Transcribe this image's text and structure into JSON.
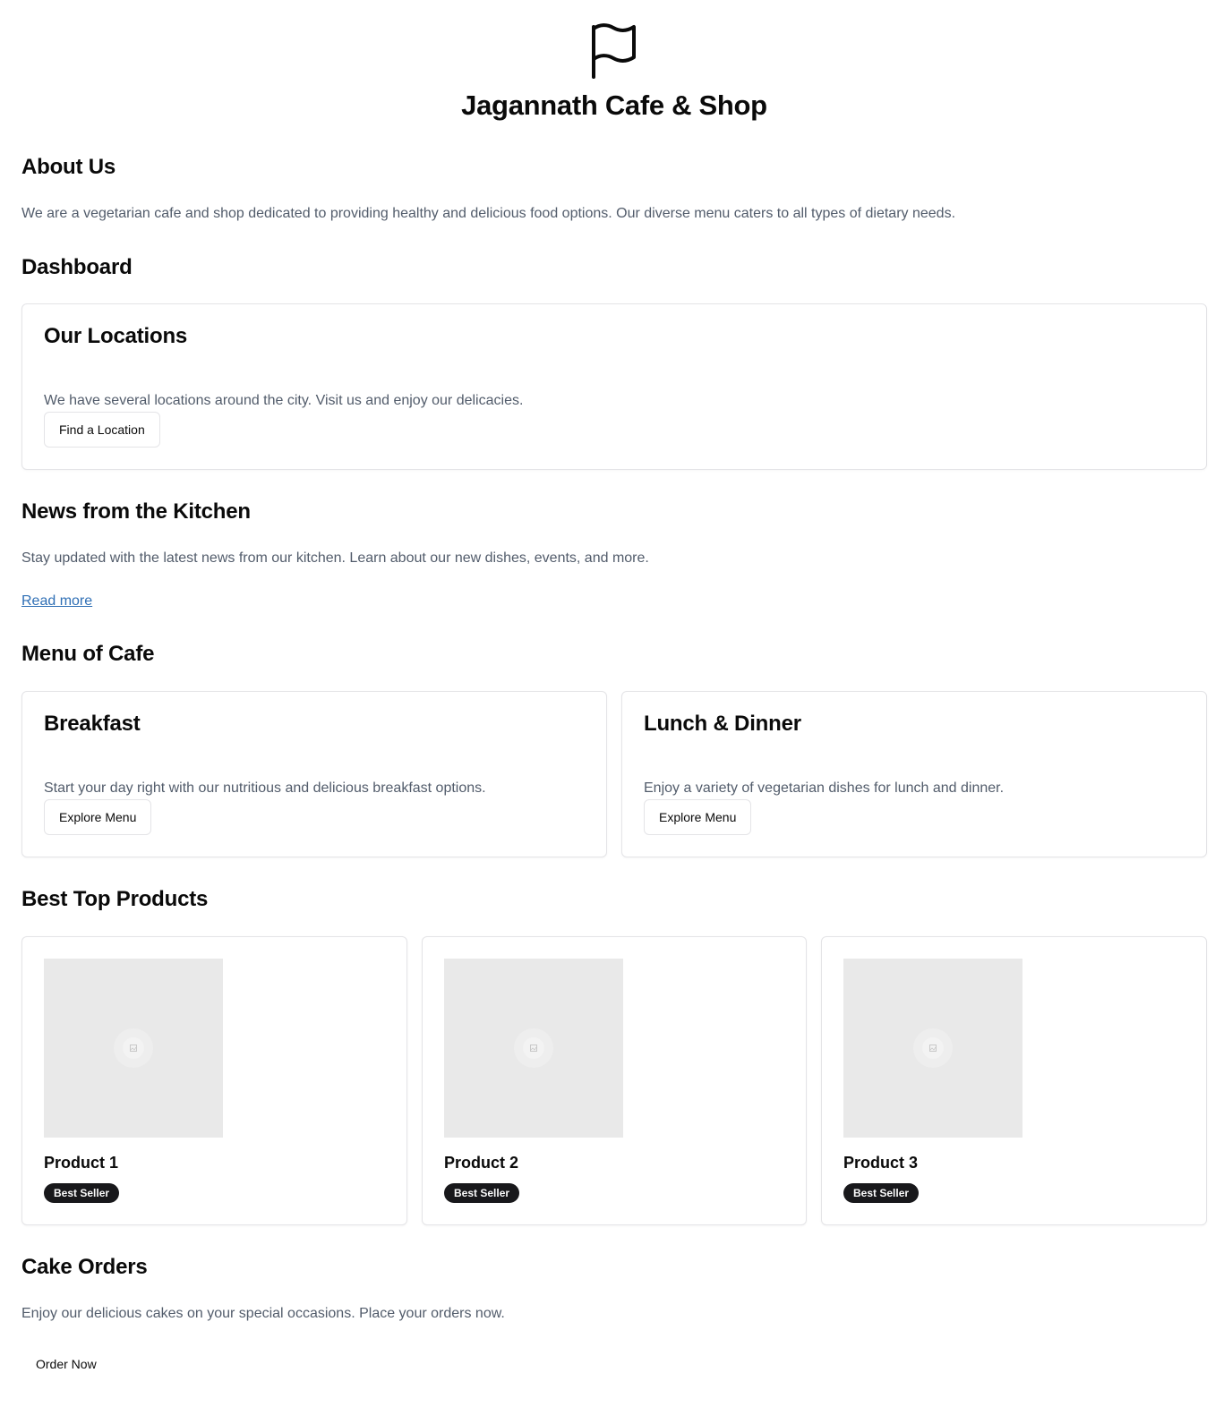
{
  "header": {
    "logo_icon": "flag-icon",
    "title": "Jagannath Cafe & Shop"
  },
  "about": {
    "heading": "About Us",
    "text": "We are a vegetarian cafe and shop dedicated to providing healthy and delicious food options. Our diverse menu caters to all types of dietary needs."
  },
  "dashboard": {
    "heading": "Dashboard",
    "locations": {
      "title": "Our Locations",
      "text": "We have several locations around the city. Visit us and enjoy our delicacies.",
      "button": "Find a Location"
    }
  },
  "news": {
    "heading": "News from the Kitchen",
    "text": "Stay updated with the latest news from our kitchen. Learn about our new dishes, events, and more.",
    "link": "Read more"
  },
  "menu": {
    "heading": "Menu of Cafe",
    "cards": [
      {
        "title": "Breakfast",
        "text": "Start your day right with our nutritious and delicious breakfast options.",
        "button": "Explore Menu"
      },
      {
        "title": "Lunch & Dinner",
        "text": "Enjoy a variety of vegetarian dishes for lunch and dinner.",
        "button": "Explore Menu"
      }
    ]
  },
  "products": {
    "heading": "Best Top Products",
    "items": [
      {
        "name": "Product 1",
        "badge": "Best Seller",
        "image_icon": "image-placeholder-icon"
      },
      {
        "name": "Product 2",
        "badge": "Best Seller",
        "image_icon": "image-placeholder-icon"
      },
      {
        "name": "Product 3",
        "badge": "Best Seller",
        "image_icon": "image-placeholder-icon"
      }
    ]
  },
  "cakes": {
    "heading": "Cake Orders",
    "text": "Enjoy our delicious cakes on your special occasions. Place your orders now.",
    "button": "Order Now"
  },
  "colors": {
    "text_primary": "#0a0a0a",
    "text_muted": "#525c6b",
    "link": "#2f6fb5",
    "badge_bg": "#18181b",
    "card_border": "#e4e4e7",
    "image_placeholder": "#e9e9e9"
  }
}
